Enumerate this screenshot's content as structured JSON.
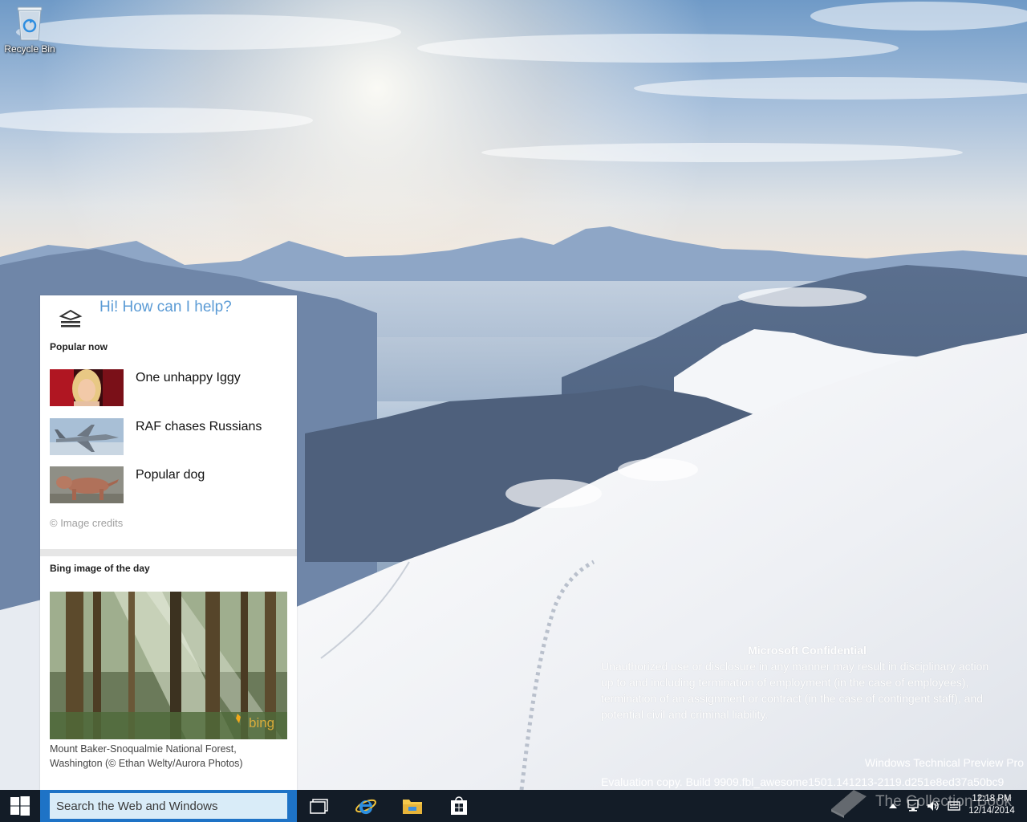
{
  "desktop": {
    "icons": [
      {
        "label": "Recycle Bin"
      }
    ],
    "watermark": {
      "title": "Microsoft Confidential",
      "lines": [
        "Unauthorized use or disclosure in any manner may result in disciplinary action",
        "up to and including termination of employment (in the case of employees),",
        "termination of an assignment or contract (in the case of contingent staff), and",
        "potential civil and criminal liability."
      ],
      "edition": "Windows Technical Preview Pro",
      "build": "Evaluation copy. Build 9909.fbl_awesome1501.141213-2119.d251e8ed37a50bc9"
    },
    "site_watermark": "The Collection Book"
  },
  "cortana": {
    "greeting": "Hi! How can I help?",
    "popular_heading": "Popular now",
    "news": [
      {
        "label": "One unhappy Iggy",
        "thumb": "woman-portrait"
      },
      {
        "label": "RAF chases Russians",
        "thumb": "fighter-jet"
      },
      {
        "label": "Popular dog",
        "thumb": "brown-dog"
      }
    ],
    "credits": "© Image credits",
    "bing_heading": "Bing image of the day",
    "bing_logo": "bing",
    "bing_caption": "Mount Baker-Snoqualmie National Forest, Washington (© Ethan Welty/Aurora Photos)"
  },
  "taskbar": {
    "search_placeholder": "Search the Web and Windows",
    "apps": [
      "task-view",
      "internet-explorer",
      "file-explorer",
      "windows-store"
    ],
    "clock": {
      "time": "12:18 PM",
      "date": "12/14/2014"
    }
  },
  "colors": {
    "taskbar": "#131c27",
    "search_accent": "#1e73c6",
    "search_field": "#d9ecf8",
    "cortana_greeting": "#5b9bd5"
  }
}
